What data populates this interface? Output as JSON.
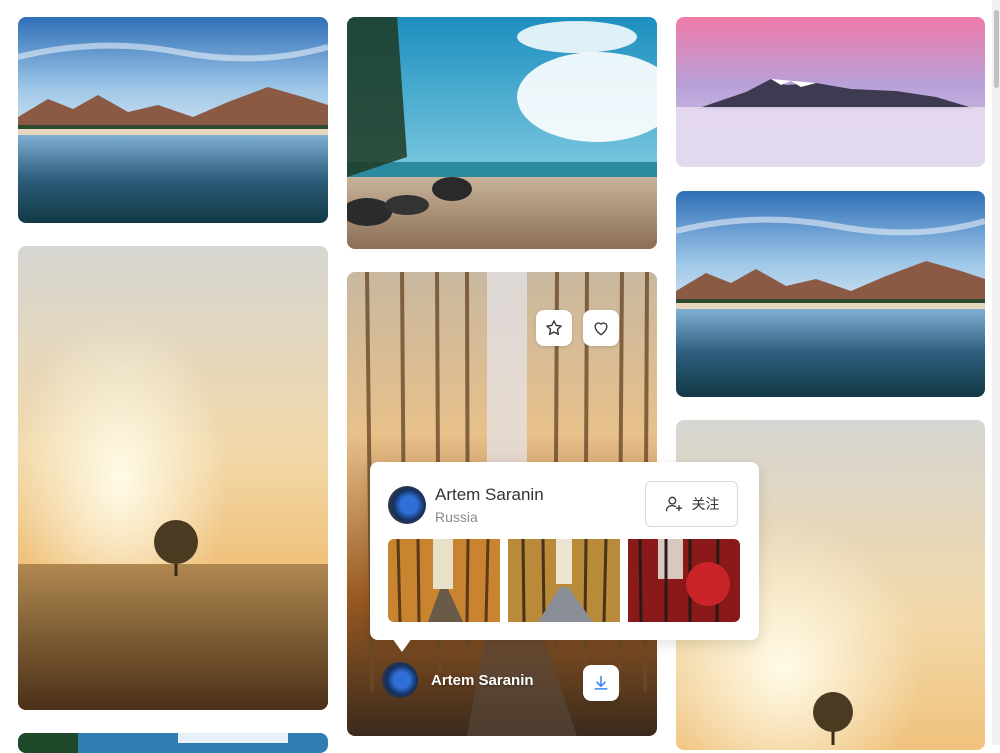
{
  "grid": {
    "photos": [
      {
        "name": "mountain-lake-1"
      },
      {
        "name": "sunrise-field-tree-1"
      },
      {
        "name": "tropical-beach"
      },
      {
        "name": "autumn-forest-road"
      },
      {
        "name": "snow-peaks-above-clouds"
      },
      {
        "name": "mountain-lake-2"
      },
      {
        "name": "sunrise-field-tree-2"
      },
      {
        "name": "beach-partial-bottom"
      }
    ]
  },
  "hover_card": {
    "author_name": "Artem Saranin"
  },
  "popover": {
    "author_name": "Artem Saranin",
    "location": "Russia",
    "follow_label": "关注",
    "thumbnails": [
      {
        "name": "thumb-forest-road-1"
      },
      {
        "name": "thumb-forest-road-2"
      },
      {
        "name": "thumb-red-forest"
      }
    ]
  },
  "icons": {
    "favorite": "star-icon",
    "like": "heart-icon",
    "download": "download-icon",
    "follow": "add-user-icon"
  },
  "colors": {
    "icon_stroke": "#333333",
    "download_accent": "#3b82f6"
  }
}
